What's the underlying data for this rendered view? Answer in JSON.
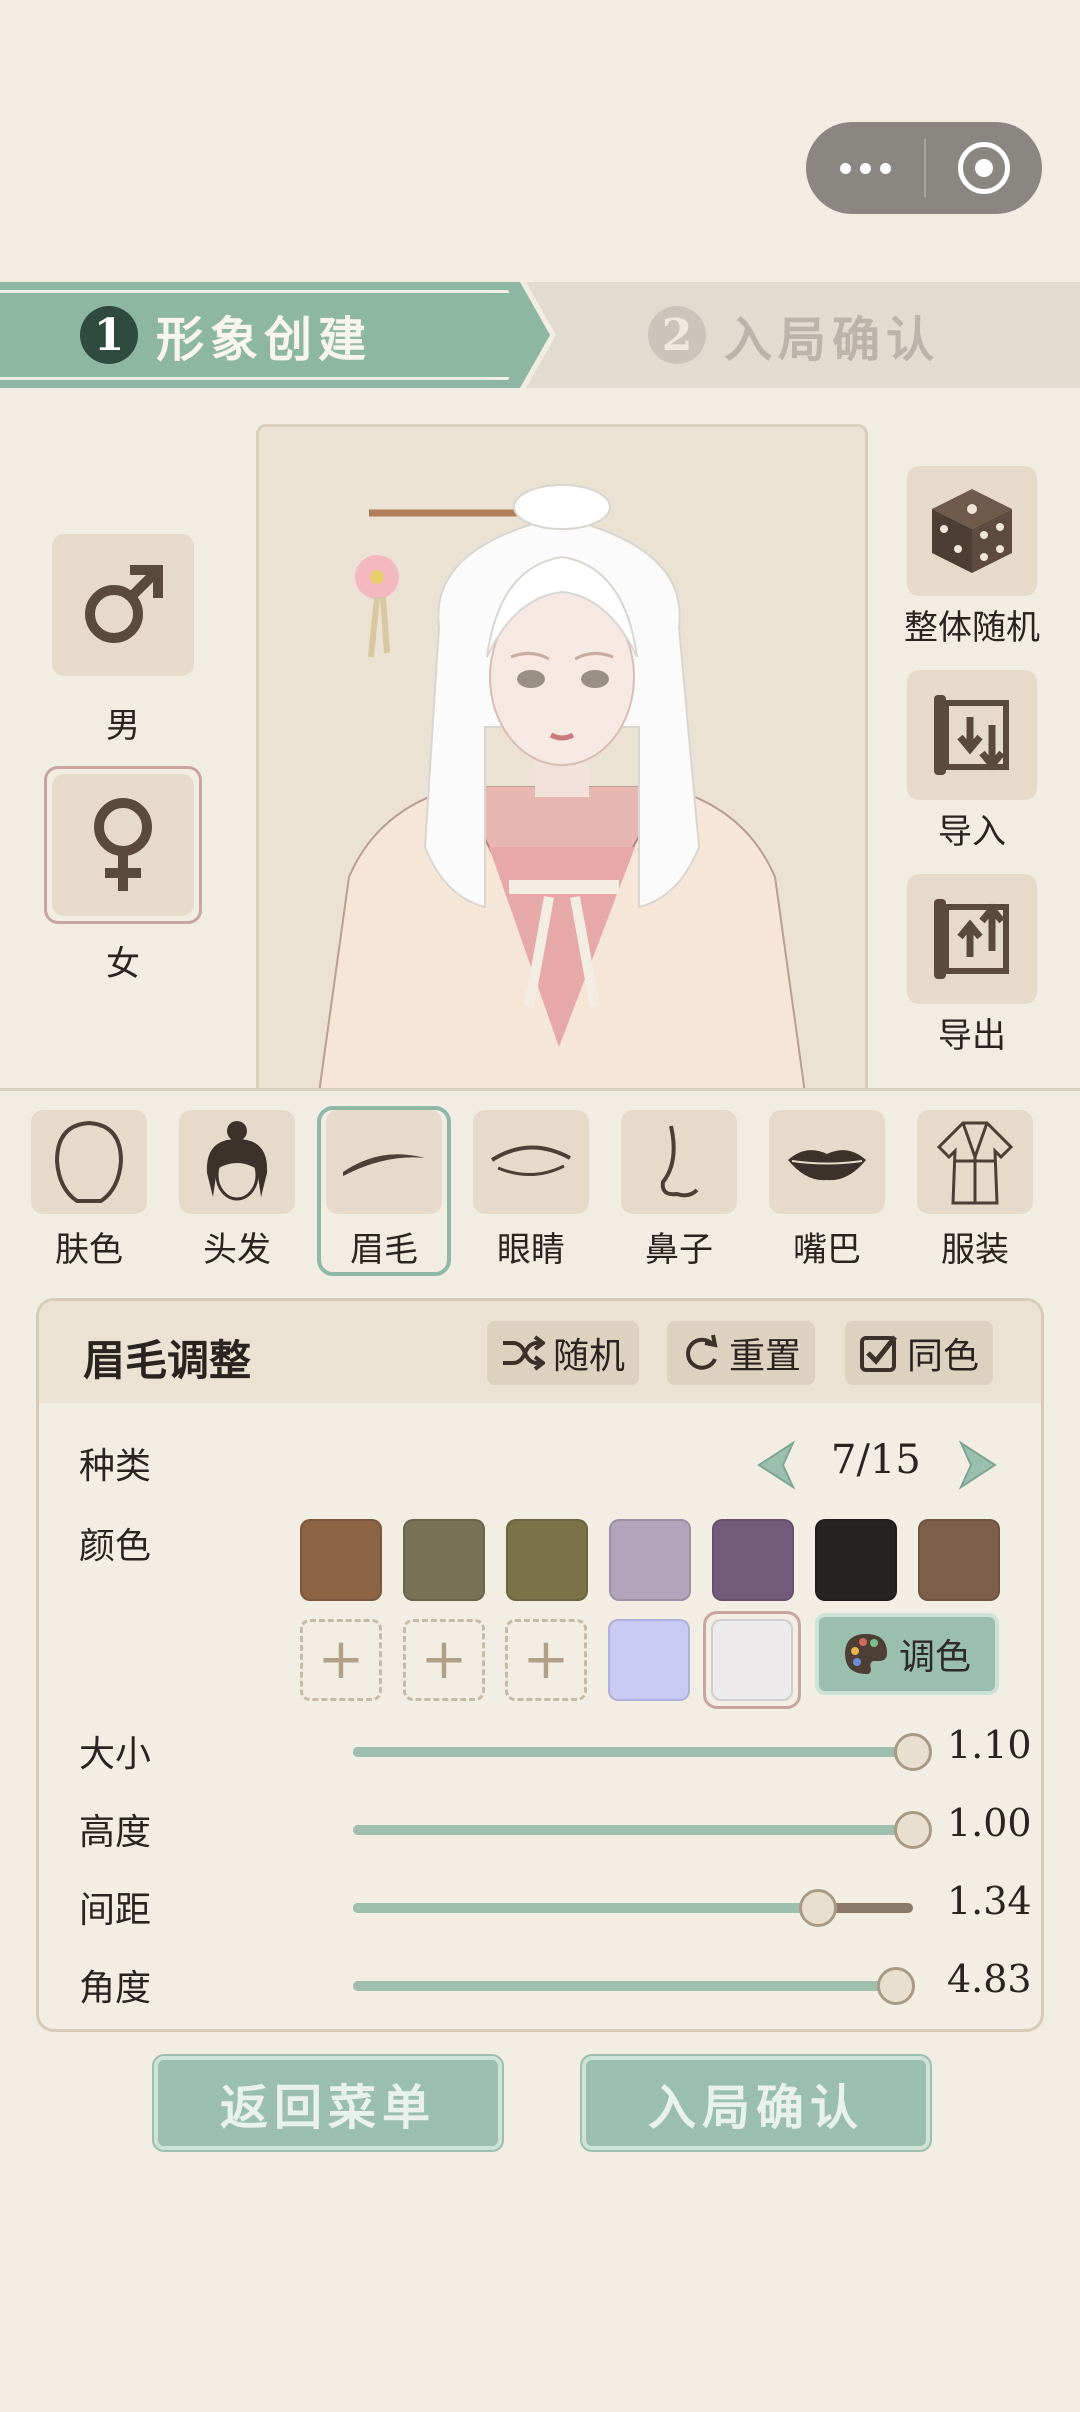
{
  "steps": [
    {
      "num": "1",
      "label": "形象创建"
    },
    {
      "num": "2",
      "label": "入局确认"
    }
  ],
  "gender": {
    "male": "男",
    "female": "女"
  },
  "side_actions": {
    "random_all": "整体随机",
    "import": "导入",
    "export": "导出"
  },
  "categories": [
    "肤色",
    "头发",
    "眉毛",
    "眼睛",
    "鼻子",
    "嘴巴",
    "服装"
  ],
  "panel": {
    "title": "眉毛调整",
    "random": "随机",
    "reset": "重置",
    "same_color": "同色",
    "type_label": "种类",
    "type_value": "7/15",
    "color_label": "颜色",
    "palette_button": "调色",
    "colors": [
      "#8b6443",
      "#787356",
      "#7c7448",
      "#b3a4bc",
      "#735c7b",
      "#272322",
      "#7e5f4b"
    ],
    "custom_colors": [
      "#c9caf4",
      "#eceaea"
    ],
    "sliders": [
      {
        "label": "大小",
        "value": "1.10",
        "fraction": 1.0
      },
      {
        "label": "高度",
        "value": "1.00",
        "fraction": 1.0
      },
      {
        "label": "间距",
        "value": "1.34",
        "fraction": 0.83
      },
      {
        "label": "角度",
        "value": "4.83",
        "fraction": 0.97
      }
    ]
  },
  "buttons": {
    "back": "返回菜单",
    "confirm": "入局确认"
  }
}
